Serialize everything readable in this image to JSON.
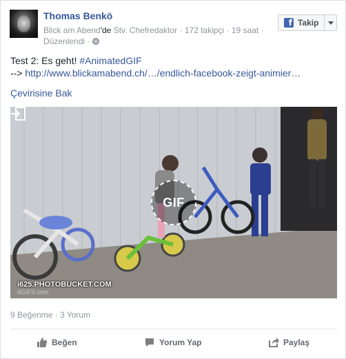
{
  "post": {
    "author": "Thomas Benkö",
    "meta_page": "Blick am Abend",
    "meta_de": "'de",
    "meta_rest": " Stv. Chefredaktor · 172 takipçi · 19 saat ·",
    "meta_line2": "Düzenlendi ·",
    "follow_label": "Takip",
    "text_line1_prefix": "Test 2: Es geht! ",
    "text_hashtag": "#AnimatedGIF",
    "text_line2_prefix": "--> ",
    "text_link": "http://www.blickamabend.ch/…/endlich-facebook-zeigt-animier…",
    "translate_label": "Çevirisine Bak",
    "gif_badge": "GIF",
    "watermark": "i625.PHOTOBUCKET.COM",
    "watermark_small": "4GIFS.com",
    "likes": "9 Beğenme",
    "comments_count": "3 Yorum",
    "counts_sep": " · "
  },
  "actions": {
    "like": "Beğen",
    "comment": "Yorum Yap",
    "share": "Paylaş"
  },
  "colors": {
    "link": "#365899",
    "meta": "#90949c",
    "action": "#616770",
    "facebook_blue": "#4267b2"
  },
  "icons": [
    "facebook-icon",
    "caret-down-icon",
    "globe-icon",
    "expand-icon",
    "thumbs-up-icon",
    "comment-icon",
    "share-icon"
  ]
}
